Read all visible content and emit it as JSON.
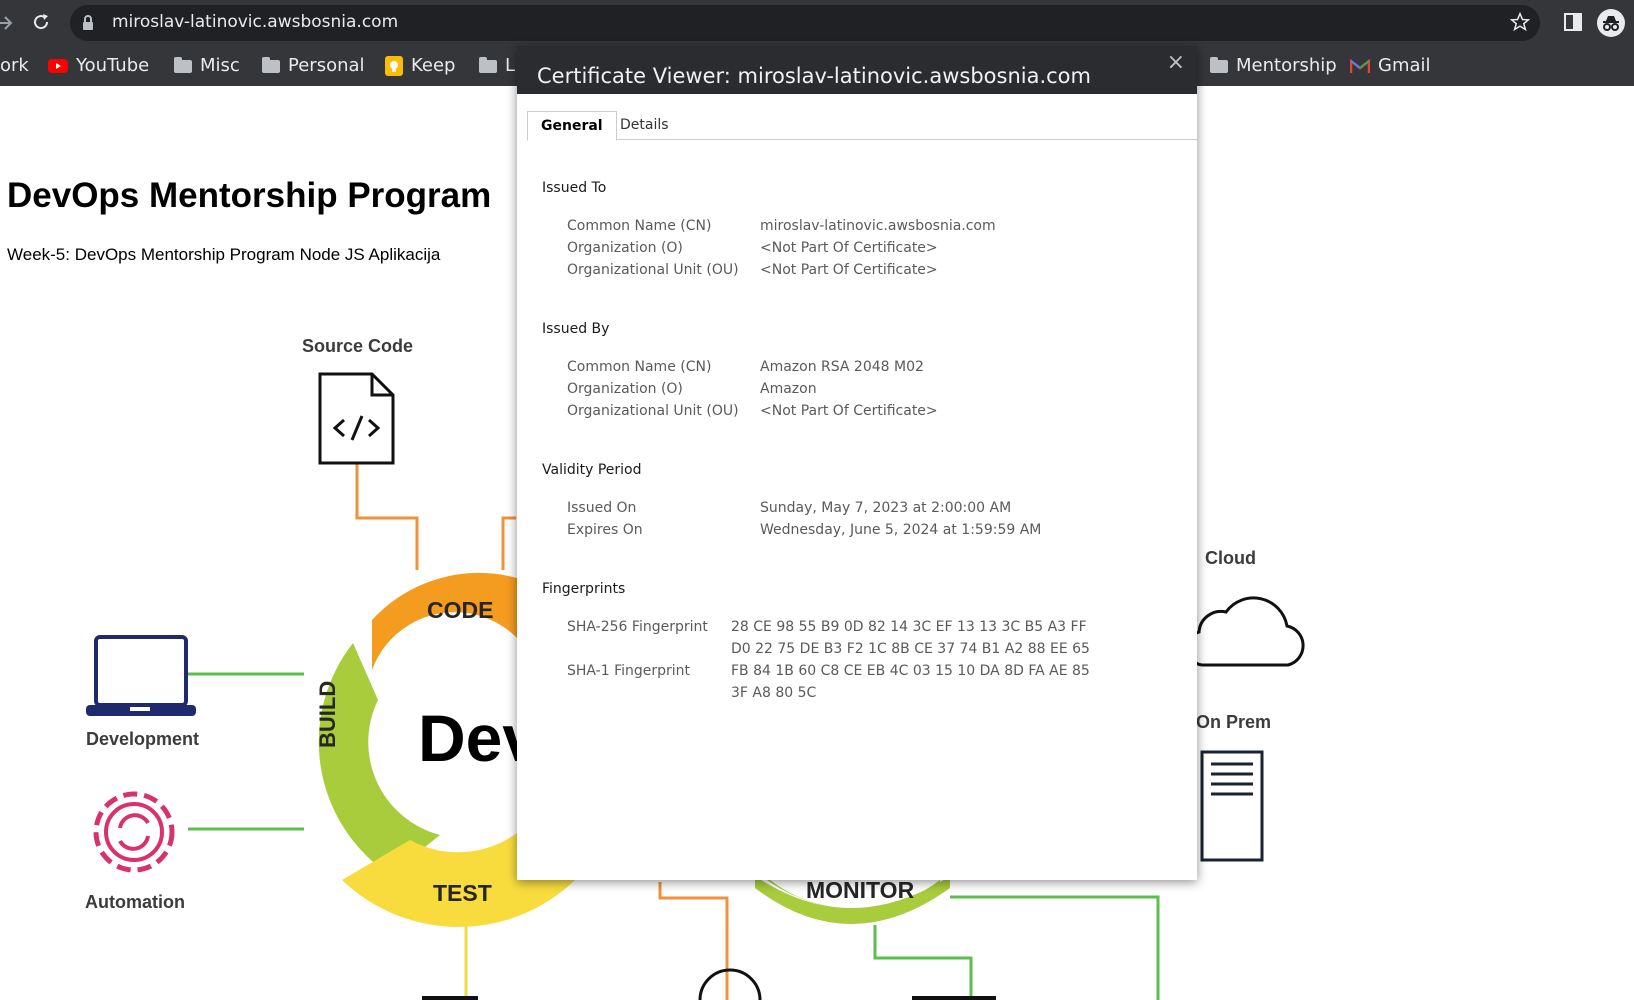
{
  "browser": {
    "url": "miroslav-latinovic.awsbosnia.com",
    "bookmarks": [
      {
        "label": "ork",
        "icon": "none"
      },
      {
        "label": "YouTube",
        "icon": "youtube-icon"
      },
      {
        "label": "Misc",
        "icon": "folder-icon"
      },
      {
        "label": "Personal",
        "icon": "folder-icon"
      },
      {
        "label": "Keep",
        "icon": "keep-icon"
      },
      {
        "label": "L",
        "icon": "folder-icon"
      },
      {
        "label": "Mentorship",
        "icon": "folder-icon"
      },
      {
        "label": "Gmail",
        "icon": "gmail-icon"
      }
    ]
  },
  "page": {
    "title": "DevOps Mentorship Program",
    "subtitle": "Week-5: DevOps Mentorship Program Node JS Aplikacija"
  },
  "diagram": {
    "source_code": "Source Code",
    "cloud": "Cloud",
    "on_prem": "On Prem",
    "development": "Development",
    "automation": "Automation",
    "code": "CODE",
    "build": "BUILD",
    "test": "TEST",
    "monitor": "MONITOR",
    "center": "Dev"
  },
  "dialog": {
    "title": "Certificate Viewer: miroslav-latinovic.awsbosnia.com",
    "close": "×",
    "tabs": [
      "General",
      "Details"
    ],
    "issued_to": {
      "heading": "Issued To",
      "cn_label": "Common Name (CN)",
      "cn": "miroslav-latinovic.awsbosnia.com",
      "o_label": "Organization (O)",
      "o": "<Not Part Of Certificate>",
      "ou_label": "Organizational Unit (OU)",
      "ou": "<Not Part Of Certificate>"
    },
    "issued_by": {
      "heading": "Issued By",
      "cn_label": "Common Name (CN)",
      "cn": "Amazon RSA 2048 M02",
      "o_label": "Organization (O)",
      "o": "Amazon",
      "ou_label": "Organizational Unit (OU)",
      "ou": "<Not Part Of Certificate>"
    },
    "validity": {
      "heading": "Validity Period",
      "issued_on_label": "Issued On",
      "issued_on": "Sunday, May 7, 2023 at 2:00:00 AM",
      "expires_on_label": "Expires On",
      "expires_on": "Wednesday, June 5, 2024 at 1:59:59 AM"
    },
    "fingerprints": {
      "heading": "Fingerprints",
      "sha256_label": "SHA-256 Fingerprint",
      "sha256_line1": "28 CE 98 55 B9 0D 82 14 3C EF 13 13 3C B5 A3 FF",
      "sha256_line2": "D0 22 75 DE B3 F2 1C 8B CE 37 74 B1 A2 88 EE 65",
      "sha1_label": "SHA-1 Fingerprint",
      "sha1_line1": "FB 84 1B 60 C8 CE EB 4C 03 15 10 DA 8D FA AE 85",
      "sha1_line2": "3F A8 80 5C"
    }
  }
}
